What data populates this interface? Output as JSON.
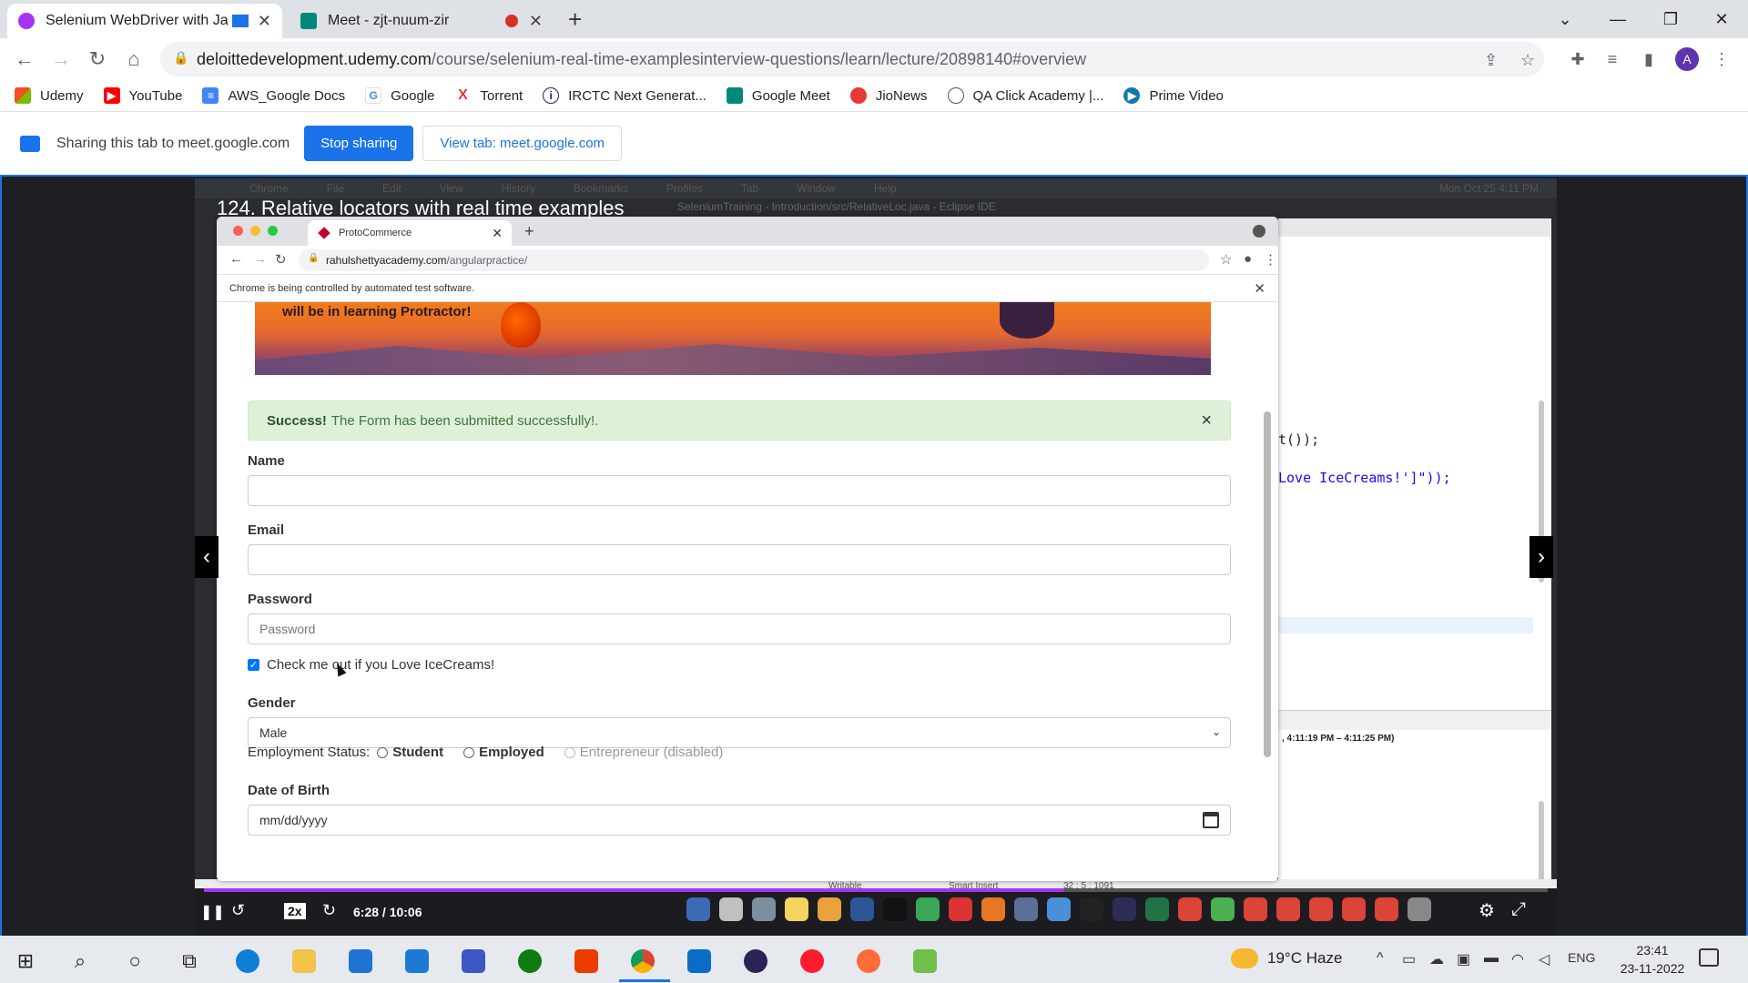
{
  "browser": {
    "tabs": [
      {
        "title": "Selenium WebDriver with Ja",
        "active": true
      },
      {
        "title": "Meet - zjt-nuum-zir",
        "active": false
      }
    ],
    "url_domain": "deloittedevelopment.udemy.com",
    "url_path": "/course/selenium-real-time-examplesinterview-questions/learn/lecture/20898140#overview",
    "profile_initial": "A",
    "bookmarks": [
      "Udemy",
      "YouTube",
      "AWS_Google Docs",
      "Google",
      "Torrent",
      "IRCTC Next Generat...",
      "Google Meet",
      "JioNews",
      "QA Click Academy |...",
      "Prime Video"
    ]
  },
  "sharebar": {
    "message": "Sharing this tab to meet.google.com",
    "stop_label": "Stop sharing",
    "view_label": "View tab: meet.google.com"
  },
  "video": {
    "title": "124. Relative locators with real time examples",
    "mac_menu": [
      "Chrome",
      "File",
      "Edit",
      "View",
      "History",
      "Bookmarks",
      "Profiles",
      "Tab",
      "Window",
      "Help"
    ],
    "mac_clock": "Mon Oct 25  4:11 PM",
    "eclipse_title": "SeleniumTraining - Introduction/src/RelativeLoc.java - Eclipse IDE",
    "code_line1": "t());",
    "code_line2": "Love IceCreams!']\"));",
    "console_time": ", 4:11:19 PM – 4:11:25 PM)",
    "status": {
      "writable": "Writable",
      "insert": "Smart Insert",
      "pos": "32 : 5 : 1091"
    },
    "speed": "2x",
    "time": "6:28 / 10:06",
    "progress": 0.64
  },
  "inner_browser": {
    "tab_title": "ProtoCommerce",
    "url_domain": "rahulshettyacademy.com",
    "url_path": "/angularpractice/",
    "info": "Chrome is being controlled by automated test software."
  },
  "form": {
    "banner_text": "will be in learning Protractor!",
    "alert_strong": "Success!",
    "alert_text": "The Form has been submitted successfully!.",
    "name_label": "Name",
    "email_label": "Email",
    "password_label": "Password",
    "password_placeholder": "Password",
    "checkbox_label": "Check me out if you Love IceCreams!",
    "checkbox_checked": true,
    "gender_label": "Gender",
    "gender_value": "Male",
    "employment_label": "Employment Status:",
    "employment_options": [
      "Student",
      "Employed",
      "Entrepreneur (disabled)"
    ],
    "dob_label": "Date of Birth",
    "dob_placeholder": "mm/dd/yyyy"
  },
  "taskbar": {
    "weather_temp": "19°C",
    "weather_text": "Haze",
    "lang": "ENG",
    "time": "23:41",
    "date": "23-11-2022"
  }
}
